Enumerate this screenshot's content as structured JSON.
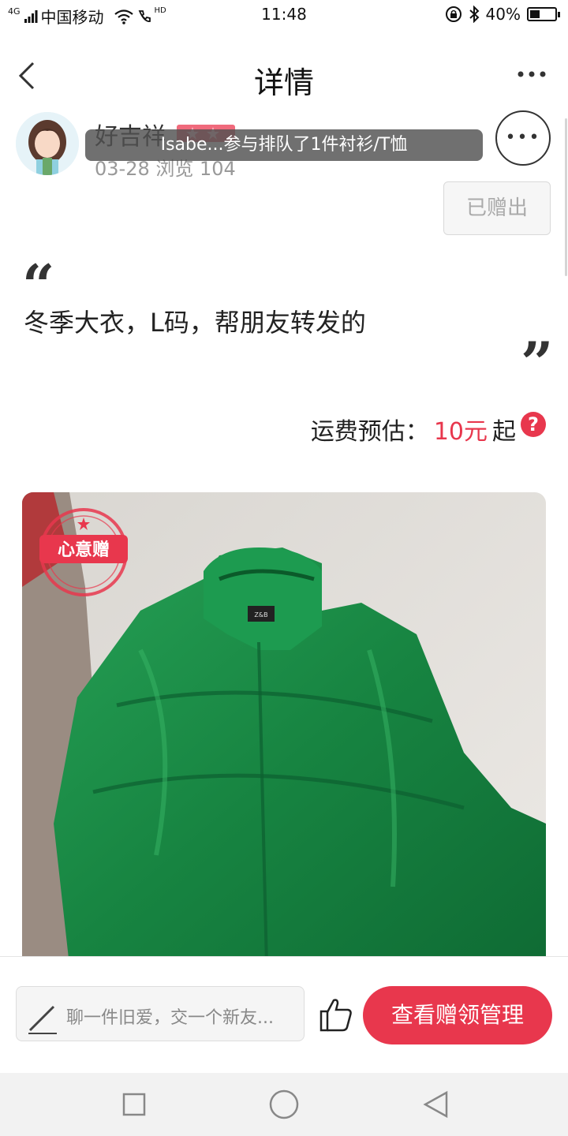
{
  "status_bar": {
    "network_type": "4G",
    "carrier": "中国移动",
    "hd": "HD",
    "time": "11:48",
    "battery": "40%",
    "battery_level": 0.4
  },
  "header": {
    "title": "详情",
    "back_icon": "back-chevron-icon",
    "more_icon": "more-horizontal-icon"
  },
  "user": {
    "name": "好吉祥",
    "meta": "03-28 浏览 104"
  },
  "toast": {
    "text": "Isabe...参与排队了1件衬衫/T恤"
  },
  "status_button": {
    "label": "已赠出"
  },
  "post": {
    "quote_open": "“",
    "quote_close": "”",
    "description": "冬季大衣，L码，帮朋友转发的"
  },
  "shipping": {
    "label": "运费预估：",
    "price": "10元",
    "suffix": "起",
    "help": "?"
  },
  "product": {
    "stamp_text": "心意赠",
    "brand_tag": "Z&B"
  },
  "bottom_bar": {
    "comment_placeholder": "聊一件旧爱，交一个新友...",
    "manage_label": "查看赠领管理"
  },
  "colors": {
    "accent": "#e8374d",
    "badge": "#f06a7c",
    "coat": "#1f8a45"
  }
}
